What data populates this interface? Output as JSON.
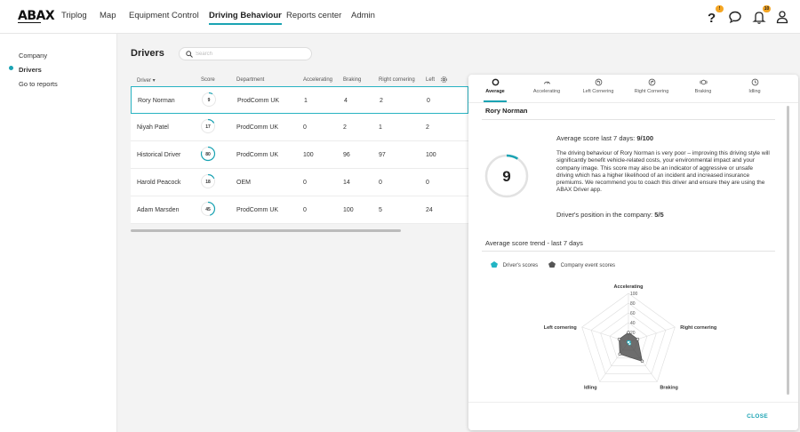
{
  "app": {
    "logo": "ABAX"
  },
  "nav": {
    "items": [
      {
        "label": "Triplog"
      },
      {
        "label": "Map"
      },
      {
        "label": "Equipment Control"
      },
      {
        "label": "Driving Behaviour",
        "active": true
      },
      {
        "label": "Reports center"
      },
      {
        "label": "Admin"
      }
    ],
    "icons": [
      {
        "name": "help-icon",
        "badge": "!"
      },
      {
        "name": "chat-icon"
      },
      {
        "name": "notifications-icon",
        "badge": "10"
      },
      {
        "name": "user-icon"
      }
    ],
    "accent": "#1aa3b3",
    "badge_color": "#f5a623"
  },
  "sidebar": {
    "items": [
      {
        "label": "Company"
      },
      {
        "label": "Drivers",
        "active": true
      },
      {
        "label": "Go to reports"
      }
    ]
  },
  "main": {
    "title": "Drivers",
    "search": {
      "placeholder": "Search",
      "value": ""
    },
    "columns": [
      "Driver",
      "Score",
      "Department",
      "Accelerating",
      "Braking",
      "Right cornering",
      "Left"
    ],
    "rows": [
      {
        "driver": "Rory Norman",
        "score": 9,
        "department": "ProdComm UK",
        "accelerating": "1",
        "braking": "4",
        "right_cornering": "2",
        "left": "0",
        "selected": true
      },
      {
        "driver": "Niyah Patel",
        "score": 17,
        "department": "ProdComm UK",
        "accelerating": "0",
        "braking": "2",
        "right_cornering": "1",
        "left": "2"
      },
      {
        "driver": "Historical Driver",
        "score": 80,
        "department": "ProdComm UK",
        "accelerating": "100",
        "braking": "96",
        "right_cornering": "97",
        "left": "100"
      },
      {
        "driver": "Harold Peacock",
        "score": 18,
        "department": "OEM",
        "accelerating": "0",
        "braking": "14",
        "right_cornering": "0",
        "left": "0"
      },
      {
        "driver": "Adam Marsden",
        "score": 45,
        "department": "ProdComm UK",
        "accelerating": "0",
        "braking": "100",
        "right_cornering": "5",
        "left": "24"
      }
    ]
  },
  "panel": {
    "tabs": [
      {
        "label": "Average",
        "icon": "circle-icon",
        "active": true
      },
      {
        "label": "Accelerating",
        "icon": "speedometer-icon"
      },
      {
        "label": "Left Cornering",
        "icon": "left-turn-icon"
      },
      {
        "label": "Right Cornering",
        "icon": "right-turn-icon"
      },
      {
        "label": "Braking",
        "icon": "brake-icon"
      },
      {
        "label": "Idling",
        "icon": "clock-icon"
      }
    ],
    "driver_name": "Rory Norman",
    "score": "9",
    "avg_prefix": "Average score last 7 days: ",
    "avg_value": "9/100",
    "description": "The driving behaviour of Rory Norman is very poor – improving this driving style will significantly benefit vehicle-related costs, your environmental impact and your company image. This score may also be an indicator of aggressive or unsafe driving which has a higher likelihood of an incident and increased insurance premiums. We recommend you to coach this driver and ensure they are using the ABAX Driver app.",
    "position_prefix": "Driver's position in the company: ",
    "position_value": "5/5",
    "trend_title": "Average score trend - last 7 days",
    "close_label": "CLOSE"
  },
  "chart_data": {
    "type": "radar",
    "axes": [
      "Accelerating",
      "Right cornering",
      "Braking",
      "Idling",
      "Left cornering"
    ],
    "ticks": [
      "100",
      "80",
      "60",
      "40",
      "20"
    ],
    "range": [
      0,
      100
    ],
    "series": [
      {
        "name": "Driver's scores",
        "color": "#22b5c4",
        "values": [
          1,
          2,
          4,
          0,
          0
        ]
      },
      {
        "name": "Company event scores",
        "color": "#555555",
        "values": [
          20,
          20,
          48,
          30,
          20
        ]
      }
    ]
  }
}
